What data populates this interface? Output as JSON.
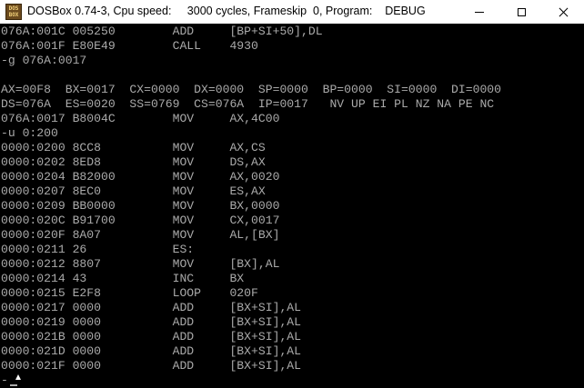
{
  "window": {
    "title": "DOSBox 0.74-3, Cpu speed:     3000 cycles, Frameskip  0, Program:    DEBUG",
    "icon_label": "DOS\nBOX",
    "icon_name": "dosbox-icon"
  },
  "console": {
    "lines": [
      "076A:001C 005250        ADD     [BP+SI+50],DL",
      "076A:001F E80E49        CALL    4930",
      "-g 076A:0017",
      "",
      "AX=00F8  BX=0017  CX=0000  DX=0000  SP=0000  BP=0000  SI=0000  DI=0000",
      "DS=076A  ES=0020  SS=0769  CS=076A  IP=0017   NV UP EI PL NZ NA PE NC",
      "076A:0017 B8004C        MOV     AX,4C00",
      "-u 0:200",
      "0000:0200 8CC8          MOV     AX,CS",
      "0000:0202 8ED8          MOV     DS,AX",
      "0000:0204 B82000        MOV     AX,0020",
      "0000:0207 8EC0          MOV     ES,AX",
      "0000:0209 BB0000        MOV     BX,0000",
      "0000:020C B91700        MOV     CX,0017",
      "0000:020F 8A07          MOV     AL,[BX]",
      "0000:0211 26            ES:",
      "0000:0212 8807          MOV     [BX],AL",
      "0000:0214 43            INC     BX",
      "0000:0215 E2F8          LOOP    020F",
      "0000:0217 0000          ADD     [BX+SI],AL",
      "0000:0219 0000          ADD     [BX+SI],AL",
      "0000:021B 0000          ADD     [BX+SI],AL",
      "0000:021D 0000          ADD     [BX+SI],AL",
      "0000:021F 0000          ADD     [BX+SI],AL"
    ],
    "prompt": "-",
    "text_color": "#aaaaaa",
    "background_color": "#000000"
  }
}
